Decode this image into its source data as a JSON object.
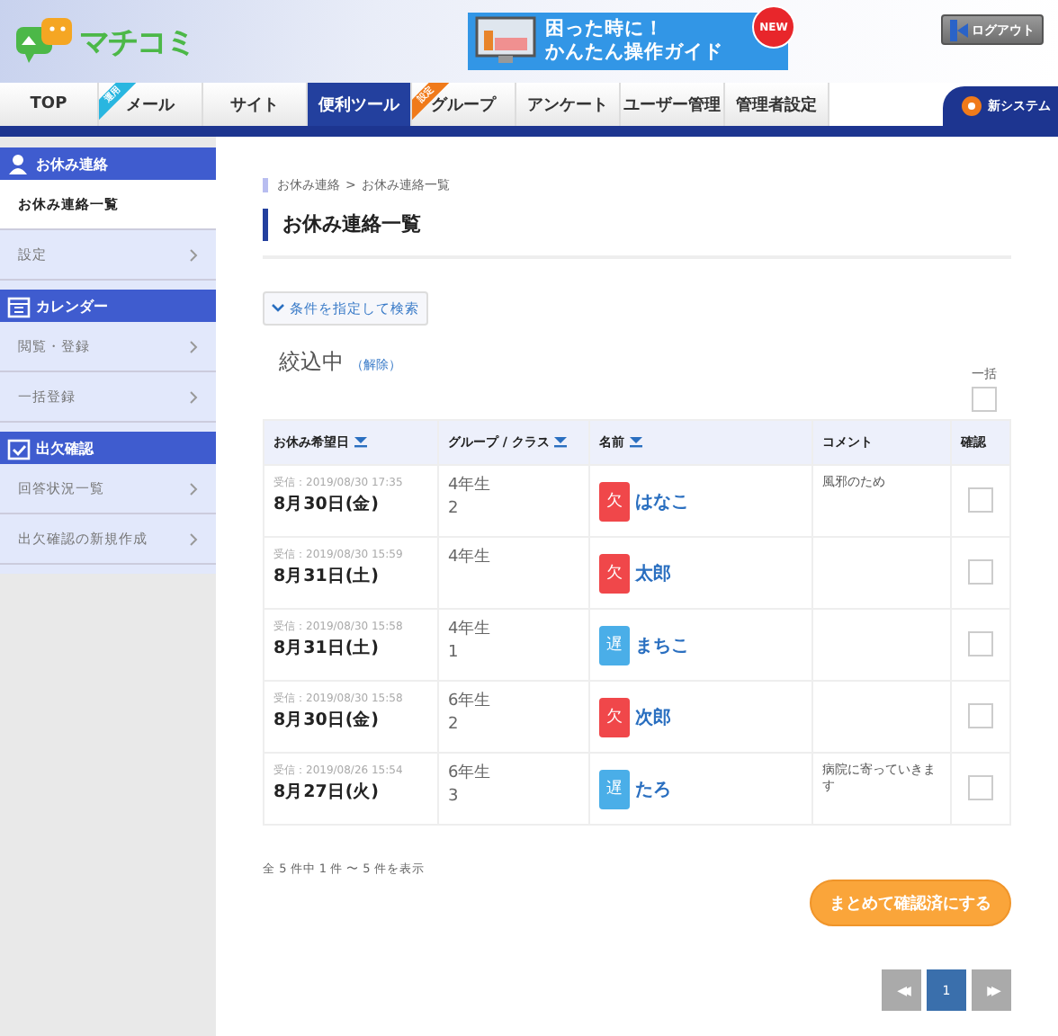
{
  "header": {
    "logo": "マチコミ",
    "banner": {
      "line1": "困った時に！",
      "line2": "かんたん操作ガイド",
      "badge": "NEW"
    },
    "logout": "ログアウト"
  },
  "nav": {
    "tabs": [
      {
        "label": "TOP",
        "selected": false
      },
      {
        "label": "メール",
        "selected": false,
        "ribbon": "運用",
        "color": "#29b6e0"
      },
      {
        "label": "サイト",
        "selected": false
      },
      {
        "label": "便利ツール",
        "selected": true
      },
      {
        "label": "グループ",
        "selected": false,
        "ribbon": "設定",
        "color": "#f07a1a"
      },
      {
        "label": "アンケート",
        "selected": false
      },
      {
        "label": "ユーザー管理",
        "selected": false
      },
      {
        "label": "管理者設定",
        "selected": false
      }
    ],
    "new_system": "新システム"
  },
  "sidebar": {
    "sections": [
      {
        "kind": "person",
        "title": "お休み連絡",
        "items": [
          {
            "label": "お休み連絡一覧",
            "selected": true
          },
          {
            "label": "設定",
            "selected": false
          }
        ]
      },
      {
        "kind": "calendar",
        "title": "カレンダー",
        "items": [
          {
            "label": "閲覧・登録",
            "selected": false
          },
          {
            "label": "一括登録",
            "selected": false
          }
        ]
      },
      {
        "kind": "check",
        "title": "出欠確認",
        "items": [
          {
            "label": "回答状況一覧",
            "selected": false
          },
          {
            "label": "出欠確認の新規作成",
            "selected": false
          }
        ]
      }
    ]
  },
  "breadcrumb": [
    "お休み連絡",
    "お休み連絡一覧"
  ],
  "breadcrumb_separator": ">",
  "title": "お休み連絡一覧",
  "search_button": "条件を指定して検索",
  "filter": {
    "label": "絞込中",
    "clear": "（解除）"
  },
  "bulk_label": "一括",
  "bulk_checked": false,
  "table": {
    "columns": [
      {
        "label": "お休み希望日",
        "sortable": true
      },
      {
        "label": "グループ / クラス",
        "sortable": true
      },
      {
        "label": "名前",
        "sortable": true
      },
      {
        "label": "コメント",
        "sortable": false
      },
      {
        "label": "確認",
        "sortable": false
      }
    ],
    "rows": [
      {
        "received": "受信：2019/08/30 17:35",
        "date": "8月30日(金)",
        "group": "4年生",
        "class": "2",
        "mark": "欠",
        "color": "#f0474a",
        "name": "はなこ",
        "comment": "風邪のため",
        "checked": false
      },
      {
        "received": "受信：2019/08/30 15:59",
        "date": "8月31日(土)",
        "group": "4年生",
        "mark": "欠",
        "color": "#f0474a",
        "name": "太郎",
        "checked": false
      },
      {
        "received": "受信：2019/08/30 15:58",
        "date": "8月31日(土)",
        "group": "4年生",
        "class": "1",
        "mark": "遅",
        "color": "#4aaee8",
        "name": "まちこ",
        "checked": false
      },
      {
        "received": "受信：2019/08/30 15:58",
        "date": "8月30日(金)",
        "group": "6年生",
        "class": "2",
        "mark": "欠",
        "color": "#f0474a",
        "name": "次郎",
        "checked": false
      },
      {
        "received": "受信：2019/08/26 15:54",
        "date": "8月27日(火)",
        "group": "6年生",
        "class": "3",
        "mark": "遅",
        "color": "#4aaee8",
        "name": "たろ",
        "comment": "病院に寄っていきます",
        "checked": false
      }
    ]
  },
  "summary": "全 5 件中 1 件 〜 5 件を表示",
  "confirm_button": "まとめて確認済にする",
  "pagination": {
    "prev": "◀◀",
    "pages": [
      {
        "label": "1",
        "selected": true
      }
    ],
    "next": "▶▶"
  }
}
